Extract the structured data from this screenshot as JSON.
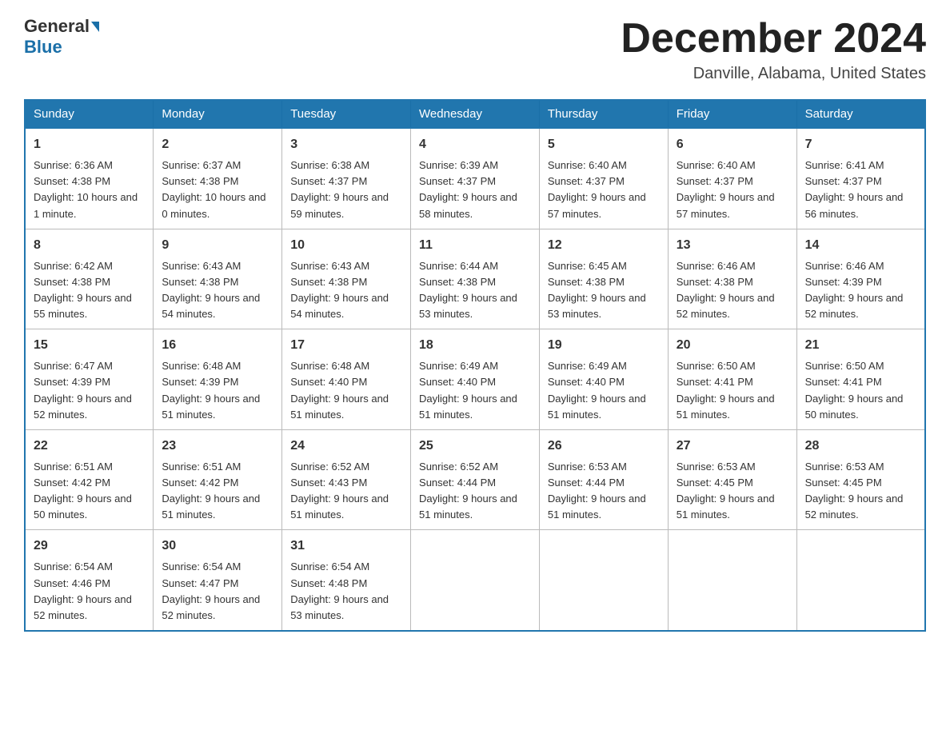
{
  "header": {
    "logo_general": "General",
    "logo_blue": "Blue",
    "month_title": "December 2024",
    "location": "Danville, Alabama, United States"
  },
  "days_of_week": [
    "Sunday",
    "Monday",
    "Tuesday",
    "Wednesday",
    "Thursday",
    "Friday",
    "Saturday"
  ],
  "weeks": [
    [
      {
        "num": "1",
        "sunrise": "6:36 AM",
        "sunset": "4:38 PM",
        "daylight": "10 hours and 1 minute."
      },
      {
        "num": "2",
        "sunrise": "6:37 AM",
        "sunset": "4:38 PM",
        "daylight": "10 hours and 0 minutes."
      },
      {
        "num": "3",
        "sunrise": "6:38 AM",
        "sunset": "4:37 PM",
        "daylight": "9 hours and 59 minutes."
      },
      {
        "num": "4",
        "sunrise": "6:39 AM",
        "sunset": "4:37 PM",
        "daylight": "9 hours and 58 minutes."
      },
      {
        "num": "5",
        "sunrise": "6:40 AM",
        "sunset": "4:37 PM",
        "daylight": "9 hours and 57 minutes."
      },
      {
        "num": "6",
        "sunrise": "6:40 AM",
        "sunset": "4:37 PM",
        "daylight": "9 hours and 57 minutes."
      },
      {
        "num": "7",
        "sunrise": "6:41 AM",
        "sunset": "4:37 PM",
        "daylight": "9 hours and 56 minutes."
      }
    ],
    [
      {
        "num": "8",
        "sunrise": "6:42 AM",
        "sunset": "4:38 PM",
        "daylight": "9 hours and 55 minutes."
      },
      {
        "num": "9",
        "sunrise": "6:43 AM",
        "sunset": "4:38 PM",
        "daylight": "9 hours and 54 minutes."
      },
      {
        "num": "10",
        "sunrise": "6:43 AM",
        "sunset": "4:38 PM",
        "daylight": "9 hours and 54 minutes."
      },
      {
        "num": "11",
        "sunrise": "6:44 AM",
        "sunset": "4:38 PM",
        "daylight": "9 hours and 53 minutes."
      },
      {
        "num": "12",
        "sunrise": "6:45 AM",
        "sunset": "4:38 PM",
        "daylight": "9 hours and 53 minutes."
      },
      {
        "num": "13",
        "sunrise": "6:46 AM",
        "sunset": "4:38 PM",
        "daylight": "9 hours and 52 minutes."
      },
      {
        "num": "14",
        "sunrise": "6:46 AM",
        "sunset": "4:39 PM",
        "daylight": "9 hours and 52 minutes."
      }
    ],
    [
      {
        "num": "15",
        "sunrise": "6:47 AM",
        "sunset": "4:39 PM",
        "daylight": "9 hours and 52 minutes."
      },
      {
        "num": "16",
        "sunrise": "6:48 AM",
        "sunset": "4:39 PM",
        "daylight": "9 hours and 51 minutes."
      },
      {
        "num": "17",
        "sunrise": "6:48 AM",
        "sunset": "4:40 PM",
        "daylight": "9 hours and 51 minutes."
      },
      {
        "num": "18",
        "sunrise": "6:49 AM",
        "sunset": "4:40 PM",
        "daylight": "9 hours and 51 minutes."
      },
      {
        "num": "19",
        "sunrise": "6:49 AM",
        "sunset": "4:40 PM",
        "daylight": "9 hours and 51 minutes."
      },
      {
        "num": "20",
        "sunrise": "6:50 AM",
        "sunset": "4:41 PM",
        "daylight": "9 hours and 51 minutes."
      },
      {
        "num": "21",
        "sunrise": "6:50 AM",
        "sunset": "4:41 PM",
        "daylight": "9 hours and 50 minutes."
      }
    ],
    [
      {
        "num": "22",
        "sunrise": "6:51 AM",
        "sunset": "4:42 PM",
        "daylight": "9 hours and 50 minutes."
      },
      {
        "num": "23",
        "sunrise": "6:51 AM",
        "sunset": "4:42 PM",
        "daylight": "9 hours and 51 minutes."
      },
      {
        "num": "24",
        "sunrise": "6:52 AM",
        "sunset": "4:43 PM",
        "daylight": "9 hours and 51 minutes."
      },
      {
        "num": "25",
        "sunrise": "6:52 AM",
        "sunset": "4:44 PM",
        "daylight": "9 hours and 51 minutes."
      },
      {
        "num": "26",
        "sunrise": "6:53 AM",
        "sunset": "4:44 PM",
        "daylight": "9 hours and 51 minutes."
      },
      {
        "num": "27",
        "sunrise": "6:53 AM",
        "sunset": "4:45 PM",
        "daylight": "9 hours and 51 minutes."
      },
      {
        "num": "28",
        "sunrise": "6:53 AM",
        "sunset": "4:45 PM",
        "daylight": "9 hours and 52 minutes."
      }
    ],
    [
      {
        "num": "29",
        "sunrise": "6:54 AM",
        "sunset": "4:46 PM",
        "daylight": "9 hours and 52 minutes."
      },
      {
        "num": "30",
        "sunrise": "6:54 AM",
        "sunset": "4:47 PM",
        "daylight": "9 hours and 52 minutes."
      },
      {
        "num": "31",
        "sunrise": "6:54 AM",
        "sunset": "4:48 PM",
        "daylight": "9 hours and 53 minutes."
      },
      null,
      null,
      null,
      null
    ]
  ]
}
